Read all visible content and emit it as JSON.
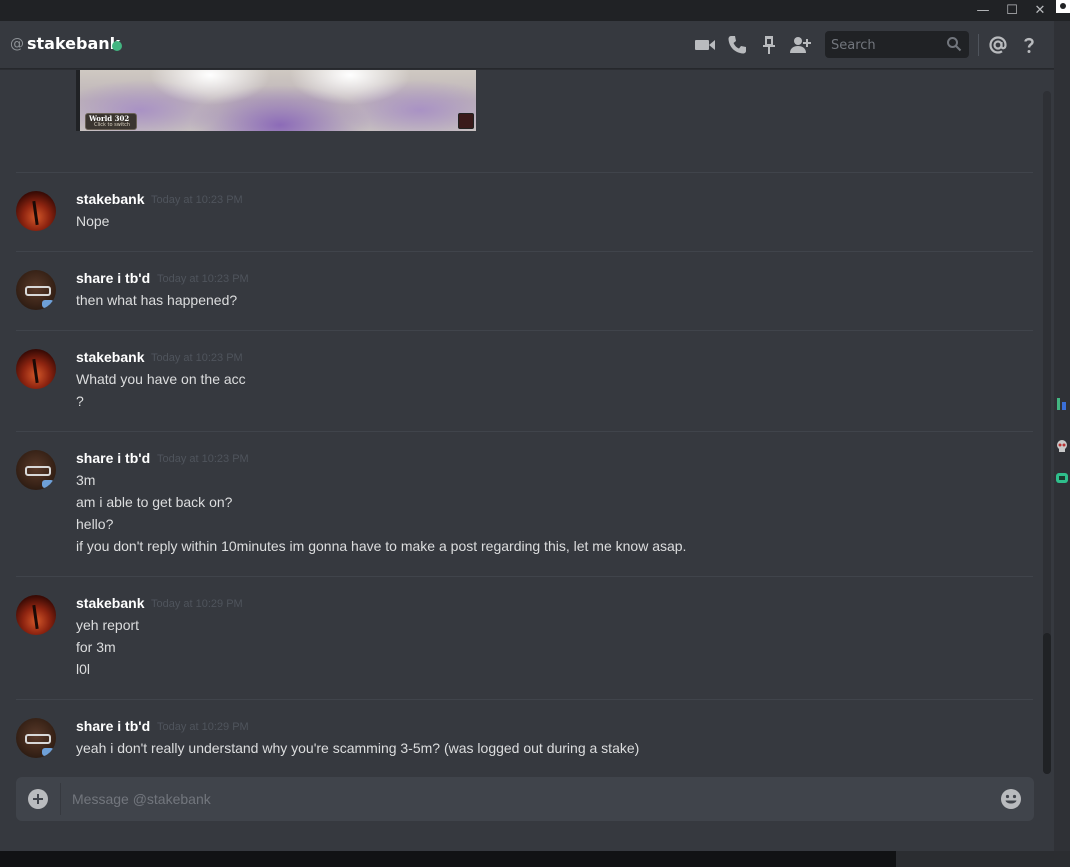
{
  "window": {
    "min_label": "—",
    "max_label": "☐",
    "close_label": "✕"
  },
  "header": {
    "at_symbol": "@",
    "channel_name": "stakebank",
    "status_color": "#43b581",
    "icons": [
      "video-call-icon",
      "voice-call-icon",
      "pin-icon",
      "add-friend-icon",
      "search-icon",
      "mention-icon",
      "help-icon"
    ],
    "search_placeholder": "Search"
  },
  "embed": {
    "world_title": "World 302",
    "world_subtitle": "Click to switch"
  },
  "messages": [
    {
      "author": "stakebank",
      "timestamp": "Today at 10:23 PM",
      "lines": [
        "Nope"
      ]
    },
    {
      "author": "share i tb'd",
      "timestamp": "Today at 10:23 PM",
      "lines": [
        "then what has happened?"
      ]
    },
    {
      "author": "stakebank",
      "timestamp": "Today at 10:23 PM",
      "lines": [
        "Whatd you have on the acc",
        "?"
      ]
    },
    {
      "author": "share i tb'd",
      "timestamp": "Today at 10:23 PM",
      "lines": [
        "3m",
        "am i able to get back on?",
        "hello?",
        "if you don't reply within 10minutes im gonna have to make a post regarding this, let me know asap."
      ]
    },
    {
      "author": "stakebank",
      "timestamp": "Today at 10:29 PM",
      "lines": [
        "yeh report",
        "for 3m",
        "l0l"
      ]
    },
    {
      "author": "share i tb'd",
      "timestamp": "Today at 10:29 PM",
      "lines": [
        "yeah i don't really understand why you're scamming 3-5m? (was logged out during a stake)"
      ]
    }
  ],
  "composer": {
    "placeholder": "Message @stakebank"
  },
  "colors": {
    "background": "#36393f",
    "accent_online": "#43b581",
    "text": "#dcddde",
    "timestamp": "#4f545c"
  }
}
